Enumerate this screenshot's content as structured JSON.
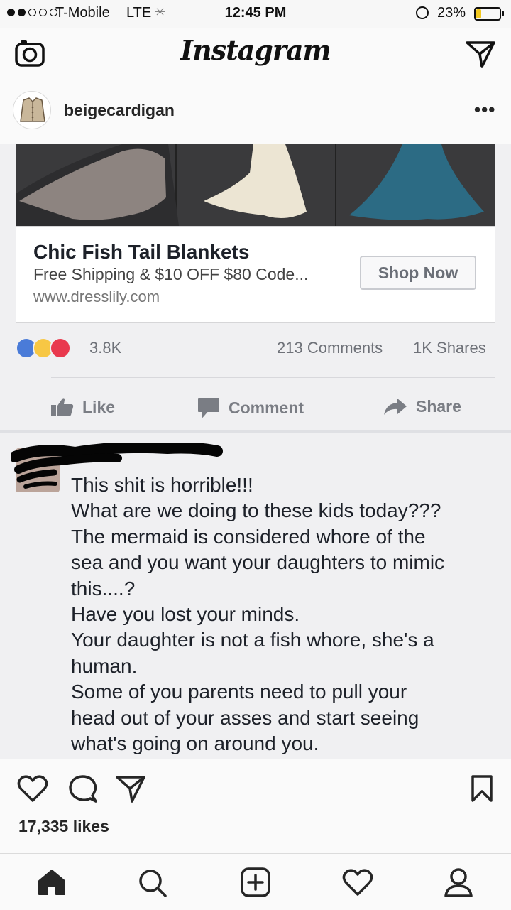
{
  "status_bar": {
    "carrier": "T-Mobile",
    "network": "LTE",
    "time": "12:45 PM",
    "battery_percent": "23%",
    "battery_level": 0.23,
    "signal_bars_filled": 2,
    "signal_bars_total": 5
  },
  "header": {
    "title": "Instagram"
  },
  "post": {
    "username": "beigecardigan",
    "more_label": "•••",
    "likes": "17,335 likes"
  },
  "fb_ad": {
    "title": "Chic Fish Tail Blankets",
    "subtitle": "Free Shipping & $10 OFF $80 Code...",
    "url": "www.dresslily.com",
    "button": "Shop Now",
    "reactions_count": "3.8K",
    "comments_count": "213 Comments",
    "shares_count": "1K Shares",
    "actions": {
      "like": "Like",
      "comment": "Comment",
      "share": "Share"
    },
    "blanket_colors": [
      "#8d8480",
      "#ece5d3",
      "#2c6b84"
    ]
  },
  "comment_lines": [
    "This shit is horrible!!!",
    "What are we doing to these kids today???",
    "The mermaid is considered whore of the",
    "sea and you want your daughters to mimic",
    "this....?",
    "Have you lost your minds.",
    "Your daughter is not a fish whore, she's a",
    "human.",
    "Some of you parents need to pull your",
    "head out of your asses and start seeing",
    "what's going on around you."
  ],
  "icons": {
    "header_left": "camera-icon",
    "header_right": "direct-message-icon",
    "post_actions": [
      "heart-icon",
      "comment-icon",
      "share-icon",
      "bookmark-icon"
    ],
    "tabs": [
      "home-icon",
      "search-icon",
      "add-icon",
      "activity-icon",
      "profile-icon"
    ]
  },
  "colors": {
    "fb_blue": "#4a7bd8",
    "haha_yellow": "#f7c744",
    "love_red": "#e9394e",
    "battery_yellow": "#f2c81e"
  }
}
